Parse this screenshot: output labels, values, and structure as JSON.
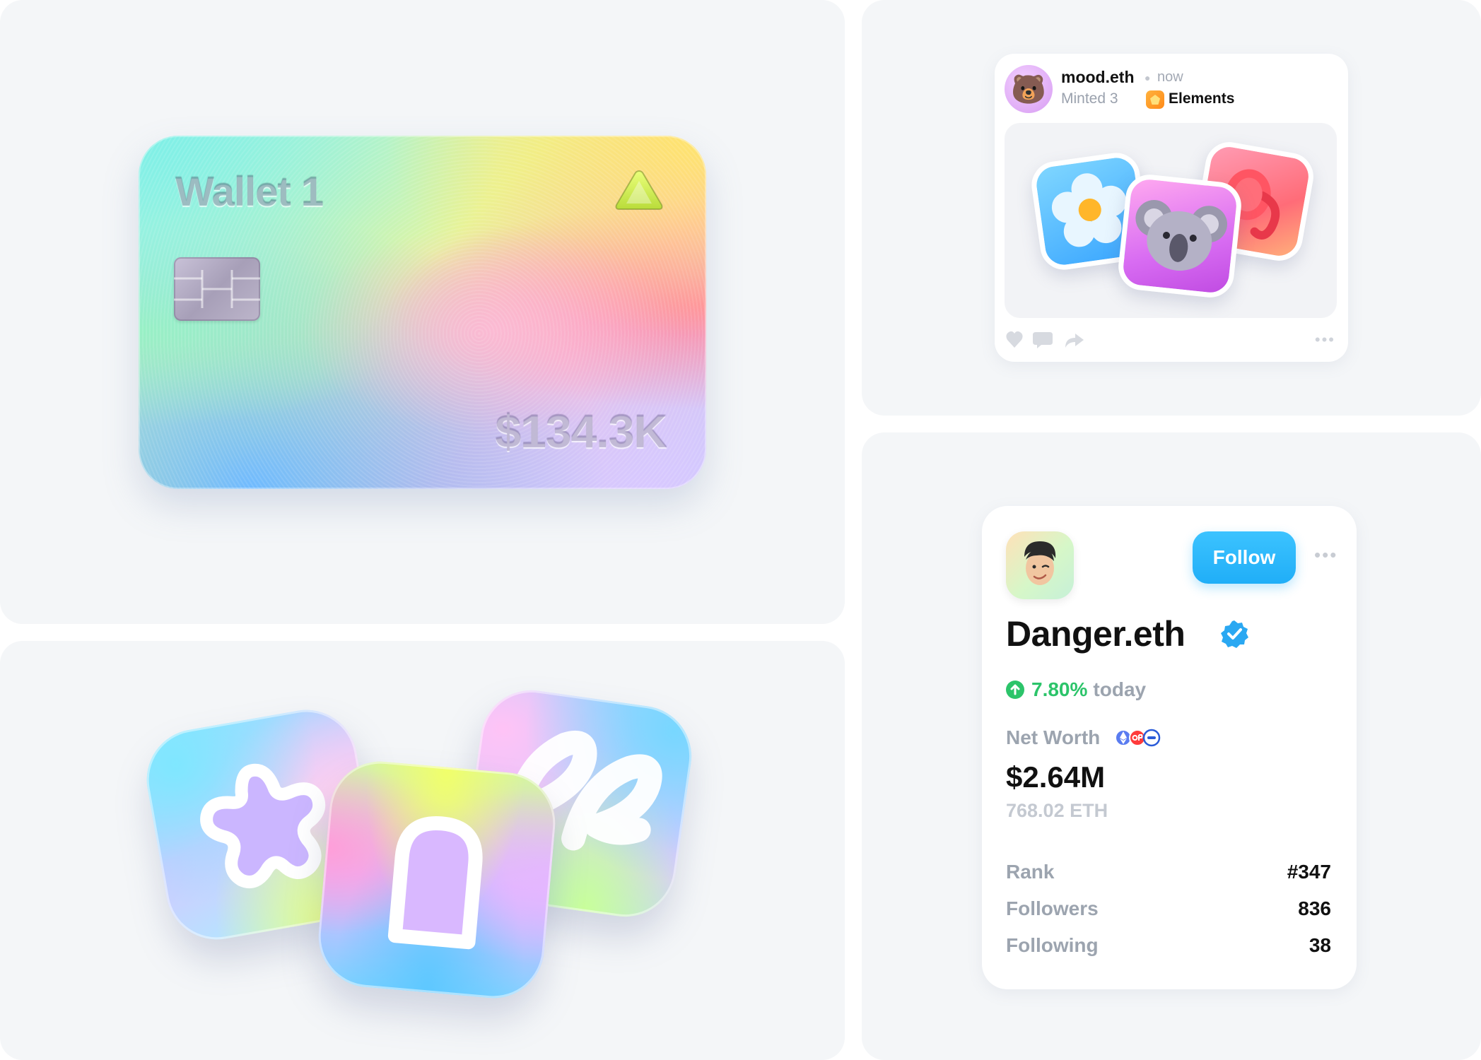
{
  "wallet": {
    "name": "Wallet 1",
    "balance": "$134.3K"
  },
  "feed_post": {
    "username": "mood.eth",
    "time": "now",
    "action": "Minted 3",
    "collection": "Elements",
    "avatar_icon": "bear-icon",
    "nfts": [
      "flower-icon",
      "koala-icon",
      "elephant-icon"
    ],
    "actions": [
      "heart-icon",
      "comment-icon",
      "share-icon",
      "more-icon"
    ]
  },
  "icon_tiles": [
    "star-icon",
    "arch-door-icon",
    "script-letter-icon"
  ],
  "profile": {
    "avatar_icon": "memoji-avatar-icon",
    "follow_label": "Follow",
    "name": "Danger.eth",
    "change_percent": "7.80%",
    "change_period": "today",
    "net_worth_label": "Net Worth",
    "net_worth": "$2.64M",
    "net_worth_eth": "768.02 ETH",
    "stats": [
      {
        "label": "Rank",
        "value": "#347"
      },
      {
        "label": "Followers",
        "value": "836"
      },
      {
        "label": "Following",
        "value": "38"
      }
    ]
  },
  "colors": {
    "accent_blue": "#20aef7",
    "positive_green": "#2cc46a",
    "muted_text": "#9ca4af",
    "panel_bg": "#f4f6f8"
  }
}
